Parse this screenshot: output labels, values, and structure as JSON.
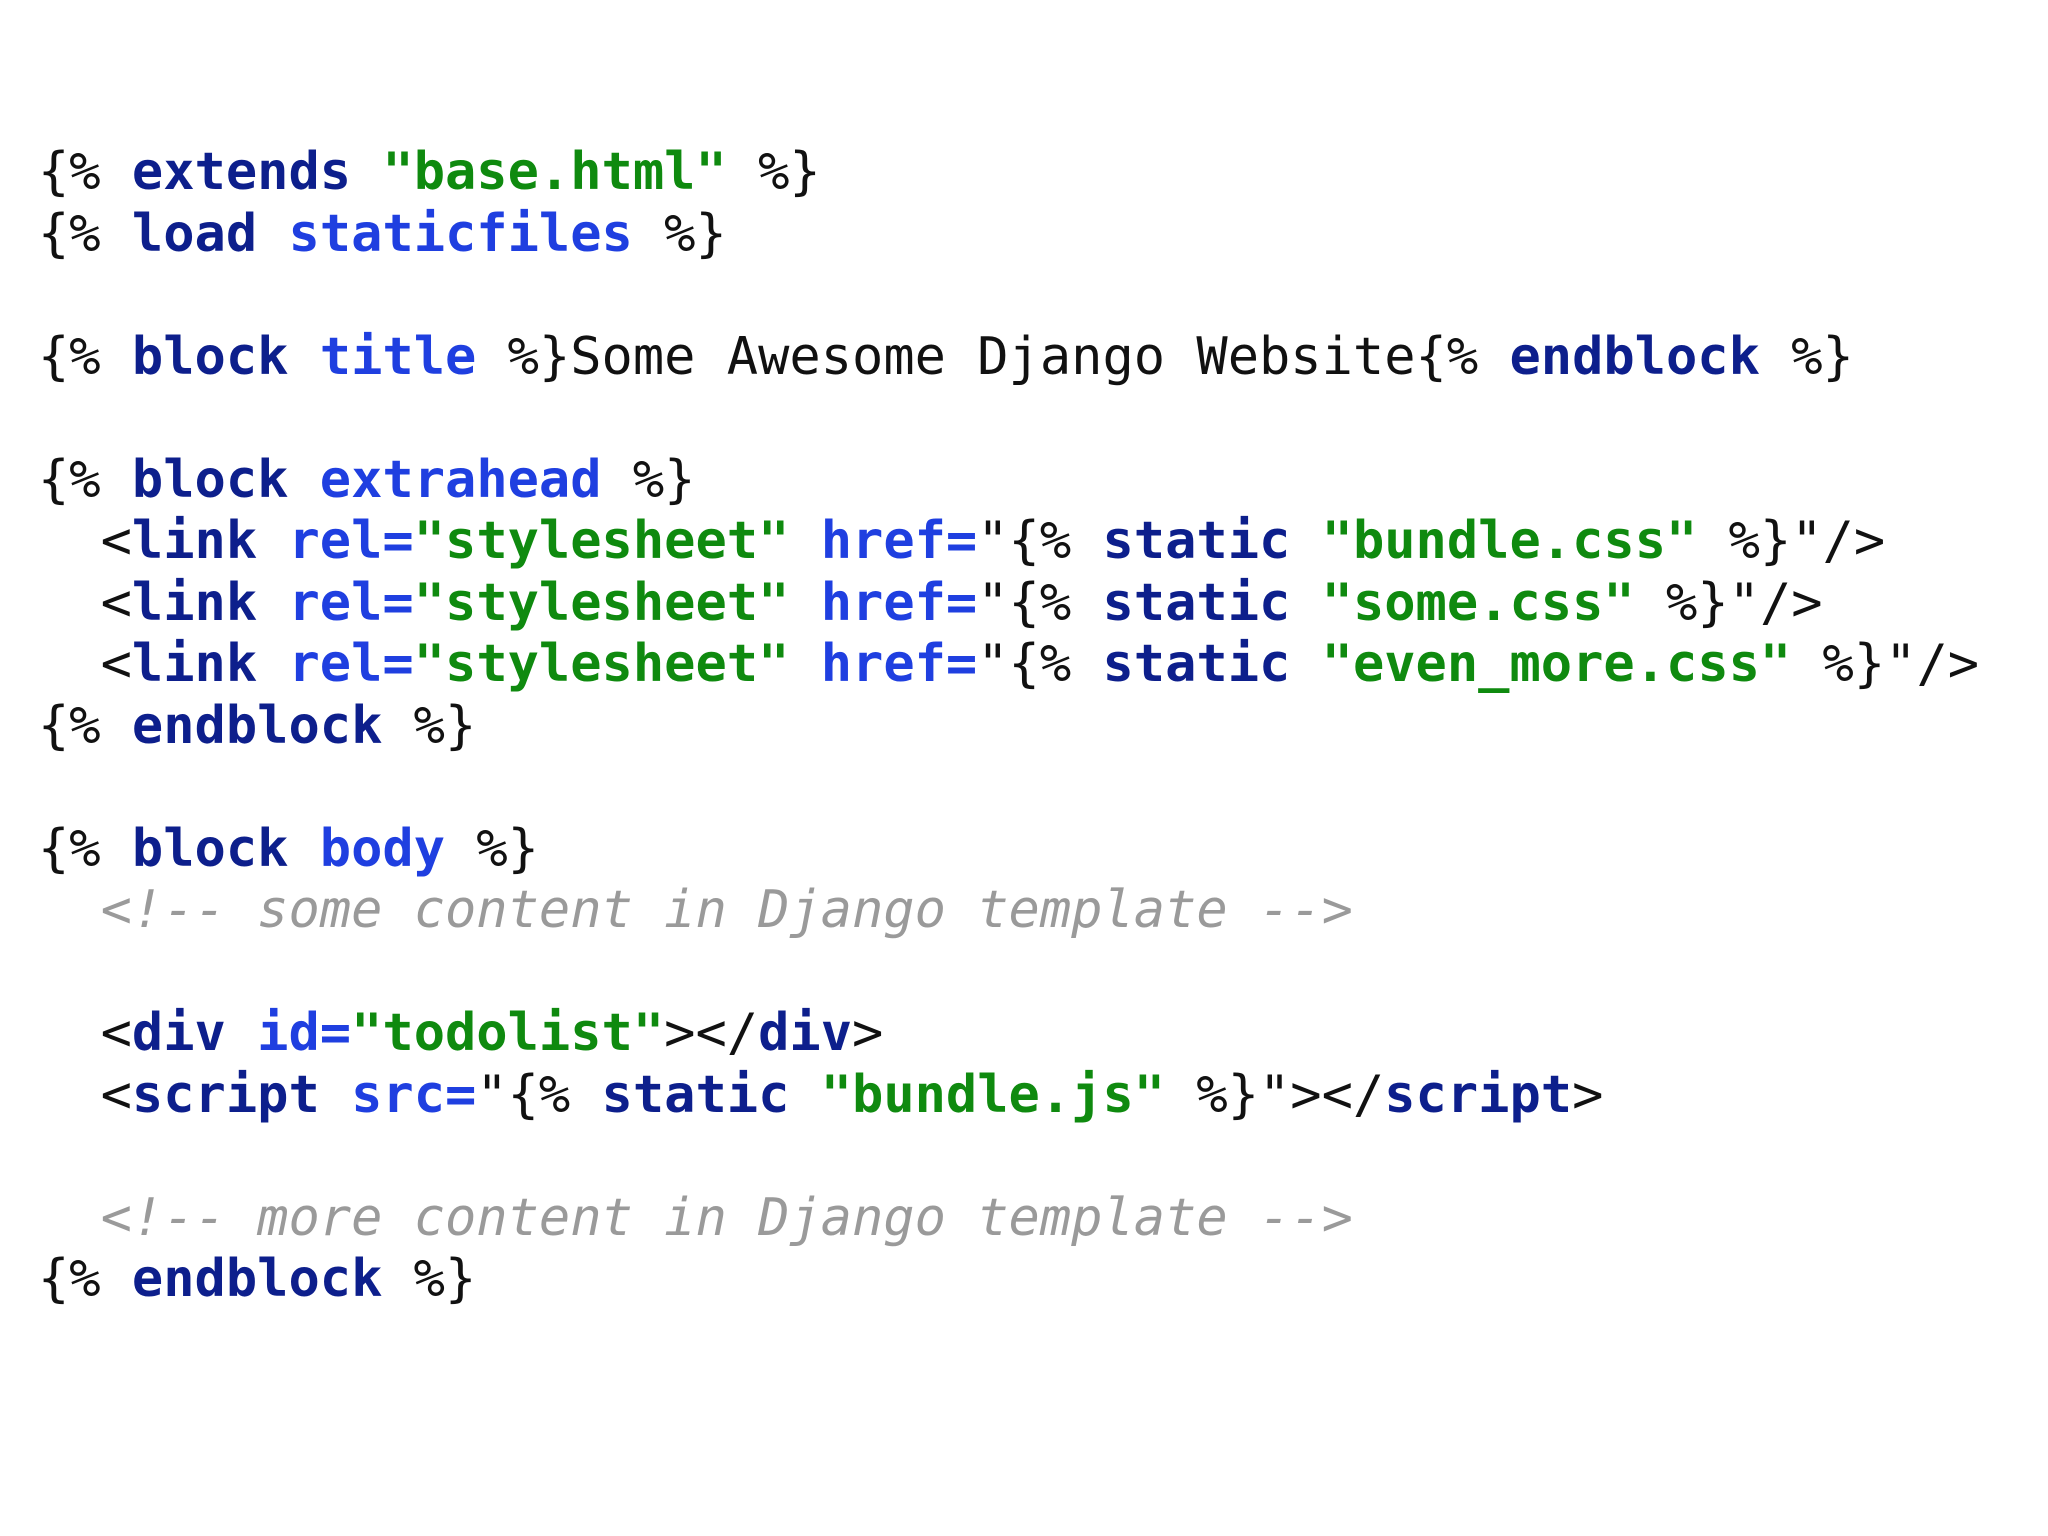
{
  "colors": {
    "background": "#ffffff",
    "plain": "#111111",
    "keyword": "#0d1f8c",
    "name": "#1f3fe0",
    "string": "#0f8a0f",
    "comment": "#9a9a9a"
  },
  "code": {
    "language": "django-template",
    "lines": [
      [
        {
          "t": "{% ",
          "c": "plain"
        },
        {
          "t": "extends",
          "c": "kw"
        },
        {
          "t": " ",
          "c": "plain"
        },
        {
          "t": "\"base.html\"",
          "c": "str"
        },
        {
          "t": " %}",
          "c": "plain"
        }
      ],
      [
        {
          "t": "{% ",
          "c": "plain"
        },
        {
          "t": "load",
          "c": "kw"
        },
        {
          "t": " ",
          "c": "plain"
        },
        {
          "t": "staticfiles",
          "c": "name"
        },
        {
          "t": " %}",
          "c": "plain"
        }
      ],
      [],
      [
        {
          "t": "{% ",
          "c": "plain"
        },
        {
          "t": "block",
          "c": "kw"
        },
        {
          "t": " ",
          "c": "plain"
        },
        {
          "t": "title",
          "c": "name"
        },
        {
          "t": " %}Some Awesome Django Website{% ",
          "c": "plain"
        },
        {
          "t": "endblock",
          "c": "kw"
        },
        {
          "t": " %}",
          "c": "plain"
        }
      ],
      [],
      [
        {
          "t": "{% ",
          "c": "plain"
        },
        {
          "t": "block",
          "c": "kw"
        },
        {
          "t": " ",
          "c": "plain"
        },
        {
          "t": "extrahead",
          "c": "name"
        },
        {
          "t": " %}",
          "c": "plain"
        }
      ],
      [
        {
          "t": "  <",
          "c": "plain"
        },
        {
          "t": "link",
          "c": "tag"
        },
        {
          "t": " ",
          "c": "plain"
        },
        {
          "t": "rel=",
          "c": "attr"
        },
        {
          "t": "\"stylesheet\"",
          "c": "str"
        },
        {
          "t": " ",
          "c": "plain"
        },
        {
          "t": "href=",
          "c": "attr"
        },
        {
          "t": "\"{% ",
          "c": "plain"
        },
        {
          "t": "static",
          "c": "kw"
        },
        {
          "t": " ",
          "c": "plain"
        },
        {
          "t": "\"bundle.css\"",
          "c": "str"
        },
        {
          "t": " %}\"/>",
          "c": "plain"
        }
      ],
      [
        {
          "t": "  <",
          "c": "plain"
        },
        {
          "t": "link",
          "c": "tag"
        },
        {
          "t": " ",
          "c": "plain"
        },
        {
          "t": "rel=",
          "c": "attr"
        },
        {
          "t": "\"stylesheet\"",
          "c": "str"
        },
        {
          "t": " ",
          "c": "plain"
        },
        {
          "t": "href=",
          "c": "attr"
        },
        {
          "t": "\"{% ",
          "c": "plain"
        },
        {
          "t": "static",
          "c": "kw"
        },
        {
          "t": " ",
          "c": "plain"
        },
        {
          "t": "\"some.css\"",
          "c": "str"
        },
        {
          "t": " %}\"/>",
          "c": "plain"
        }
      ],
      [
        {
          "t": "  <",
          "c": "plain"
        },
        {
          "t": "link",
          "c": "tag"
        },
        {
          "t": " ",
          "c": "plain"
        },
        {
          "t": "rel=",
          "c": "attr"
        },
        {
          "t": "\"stylesheet\"",
          "c": "str"
        },
        {
          "t": " ",
          "c": "plain"
        },
        {
          "t": "href=",
          "c": "attr"
        },
        {
          "t": "\"{% ",
          "c": "plain"
        },
        {
          "t": "static",
          "c": "kw"
        },
        {
          "t": " ",
          "c": "plain"
        },
        {
          "t": "\"even_more.css\"",
          "c": "str"
        },
        {
          "t": " %}\"/>",
          "c": "plain"
        }
      ],
      [
        {
          "t": "{% ",
          "c": "plain"
        },
        {
          "t": "endblock",
          "c": "kw"
        },
        {
          "t": " %}",
          "c": "plain"
        }
      ],
      [],
      [
        {
          "t": "{% ",
          "c": "plain"
        },
        {
          "t": "block",
          "c": "kw"
        },
        {
          "t": " ",
          "c": "plain"
        },
        {
          "t": "body",
          "c": "name"
        },
        {
          "t": " %}",
          "c": "plain"
        }
      ],
      [
        {
          "t": "  ",
          "c": "plain"
        },
        {
          "t": "<!-- some content in Django template -->",
          "c": "comment"
        }
      ],
      [],
      [
        {
          "t": "  <",
          "c": "plain"
        },
        {
          "t": "div",
          "c": "tag"
        },
        {
          "t": " ",
          "c": "plain"
        },
        {
          "t": "id=",
          "c": "attr"
        },
        {
          "t": "\"todolist\"",
          "c": "str"
        },
        {
          "t": "></",
          "c": "plain"
        },
        {
          "t": "div",
          "c": "tag"
        },
        {
          "t": ">",
          "c": "plain"
        }
      ],
      [
        {
          "t": "  <",
          "c": "plain"
        },
        {
          "t": "script",
          "c": "tag"
        },
        {
          "t": " ",
          "c": "plain"
        },
        {
          "t": "src=",
          "c": "attr"
        },
        {
          "t": "\"{% ",
          "c": "plain"
        },
        {
          "t": "static",
          "c": "kw"
        },
        {
          "t": " ",
          "c": "plain"
        },
        {
          "t": "\"bundle.js\"",
          "c": "str"
        },
        {
          "t": " %}\"></",
          "c": "plain"
        },
        {
          "t": "script",
          "c": "tag"
        },
        {
          "t": ">",
          "c": "plain"
        }
      ],
      [],
      [
        {
          "t": "  ",
          "c": "plain"
        },
        {
          "t": "<!-- more content in Django template -->",
          "c": "comment"
        }
      ],
      [
        {
          "t": "{% ",
          "c": "plain"
        },
        {
          "t": "endblock",
          "c": "kw"
        },
        {
          "t": " %}",
          "c": "plain"
        }
      ]
    ]
  }
}
